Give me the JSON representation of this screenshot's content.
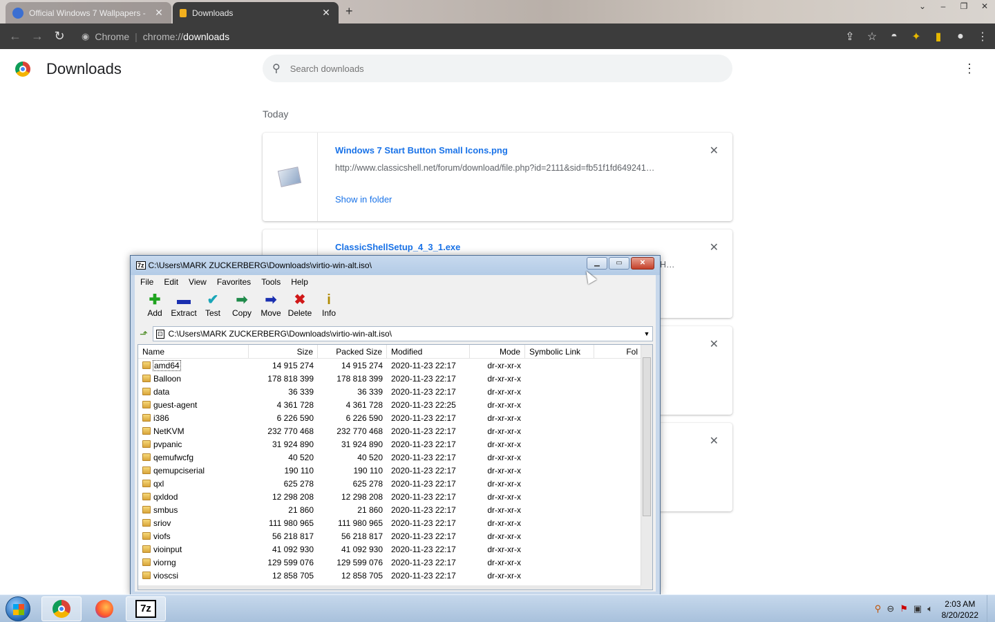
{
  "browser": {
    "tabs": [
      {
        "title": "Official Windows 7 Wallpapers -",
        "active": false
      },
      {
        "title": "Downloads",
        "active": true
      }
    ],
    "omnibox": {
      "chip": "Chrome",
      "scheme": "chrome://",
      "host": "downloads"
    }
  },
  "downloads": {
    "title": "Downloads",
    "search_placeholder": "Search downloads",
    "section_label": "Today",
    "items": [
      {
        "name": "Windows 7 Start Button Small Icons.png",
        "url": "http://www.classicshell.net/forum/download/file.php?id=2111&sid=fb51f1fd649241…",
        "action": "Show in folder"
      },
      {
        "name": "ClassicShellSetup_4_3_1.exe",
        "url_tail": "H…",
        "action": ""
      },
      {
        "name": "",
        "url": "",
        "action": ""
      },
      {
        "name": "",
        "url": "",
        "action": ""
      }
    ]
  },
  "zip": {
    "title": "C:\\Users\\MARK ZUCKERBERG\\Downloads\\virtio-win-alt.iso\\",
    "menu": [
      "File",
      "Edit",
      "View",
      "Favorites",
      "Tools",
      "Help"
    ],
    "tools": [
      {
        "label": "Add",
        "icon": "plus-icon",
        "glyph": "✚",
        "color": "#1fa31f"
      },
      {
        "label": "Extract",
        "icon": "minus-icon",
        "glyph": "▬",
        "color": "#1a2fb0"
      },
      {
        "label": "Test",
        "icon": "check-icon",
        "glyph": "✔",
        "color": "#1aa6b8"
      },
      {
        "label": "Copy",
        "icon": "copy-arrow-icon",
        "glyph": "➡",
        "color": "#1f8a4a"
      },
      {
        "label": "Move",
        "icon": "move-arrow-icon",
        "glyph": "➡",
        "color": "#1a2fb0"
      },
      {
        "label": "Delete",
        "icon": "delete-x-icon",
        "glyph": "✖",
        "color": "#d01818"
      },
      {
        "label": "Info",
        "icon": "info-icon",
        "glyph": "i",
        "color": "#b08a00"
      }
    ],
    "address": "C:\\Users\\MARK ZUCKERBERG\\Downloads\\virtio-win-alt.iso\\",
    "columns": [
      "Name",
      "Size",
      "Packed Size",
      "Modified",
      "Mode",
      "Symbolic Link",
      "Fol"
    ],
    "rows": [
      {
        "name": "amd64",
        "size": "14 915 274",
        "packed": "14 915 274",
        "modified": "2020-11-23 22:17",
        "mode": "dr-xr-xr-x"
      },
      {
        "name": "Balloon",
        "size": "178 818 399",
        "packed": "178 818 399",
        "modified": "2020-11-23 22:17",
        "mode": "dr-xr-xr-x"
      },
      {
        "name": "data",
        "size": "36 339",
        "packed": "36 339",
        "modified": "2020-11-23 22:17",
        "mode": "dr-xr-xr-x"
      },
      {
        "name": "guest-agent",
        "size": "4 361 728",
        "packed": "4 361 728",
        "modified": "2020-11-23 22:25",
        "mode": "dr-xr-xr-x"
      },
      {
        "name": "i386",
        "size": "6 226 590",
        "packed": "6 226 590",
        "modified": "2020-11-23 22:17",
        "mode": "dr-xr-xr-x"
      },
      {
        "name": "NetKVM",
        "size": "232 770 468",
        "packed": "232 770 468",
        "modified": "2020-11-23 22:17",
        "mode": "dr-xr-xr-x"
      },
      {
        "name": "pvpanic",
        "size": "31 924 890",
        "packed": "31 924 890",
        "modified": "2020-11-23 22:17",
        "mode": "dr-xr-xr-x"
      },
      {
        "name": "qemufwcfg",
        "size": "40 520",
        "packed": "40 520",
        "modified": "2020-11-23 22:17",
        "mode": "dr-xr-xr-x"
      },
      {
        "name": "qemupciserial",
        "size": "190 110",
        "packed": "190 110",
        "modified": "2020-11-23 22:17",
        "mode": "dr-xr-xr-x"
      },
      {
        "name": "qxl",
        "size": "625 278",
        "packed": "625 278",
        "modified": "2020-11-23 22:17",
        "mode": "dr-xr-xr-x"
      },
      {
        "name": "qxldod",
        "size": "12 298 208",
        "packed": "12 298 208",
        "modified": "2020-11-23 22:17",
        "mode": "dr-xr-xr-x"
      },
      {
        "name": "smbus",
        "size": "21 860",
        "packed": "21 860",
        "modified": "2020-11-23 22:17",
        "mode": "dr-xr-xr-x"
      },
      {
        "name": "sriov",
        "size": "111 980 965",
        "packed": "111 980 965",
        "modified": "2020-11-23 22:17",
        "mode": "dr-xr-xr-x"
      },
      {
        "name": "viofs",
        "size": "56 218 817",
        "packed": "56 218 817",
        "modified": "2020-11-23 22:17",
        "mode": "dr-xr-xr-x"
      },
      {
        "name": "vioinput",
        "size": "41 092 930",
        "packed": "41 092 930",
        "modified": "2020-11-23 22:17",
        "mode": "dr-xr-xr-x"
      },
      {
        "name": "viorng",
        "size": "129 599 076",
        "packed": "129 599 076",
        "modified": "2020-11-23 22:17",
        "mode": "dr-xr-xr-x"
      },
      {
        "name": "vioscsi",
        "size": "12 858 705",
        "packed": "12 858 705",
        "modified": "2020-11-23 22:17",
        "mode": "dr-xr-xr-x"
      }
    ]
  },
  "taskbar": {
    "clock_time": "2:03 AM",
    "clock_date": "8/20/2022"
  }
}
